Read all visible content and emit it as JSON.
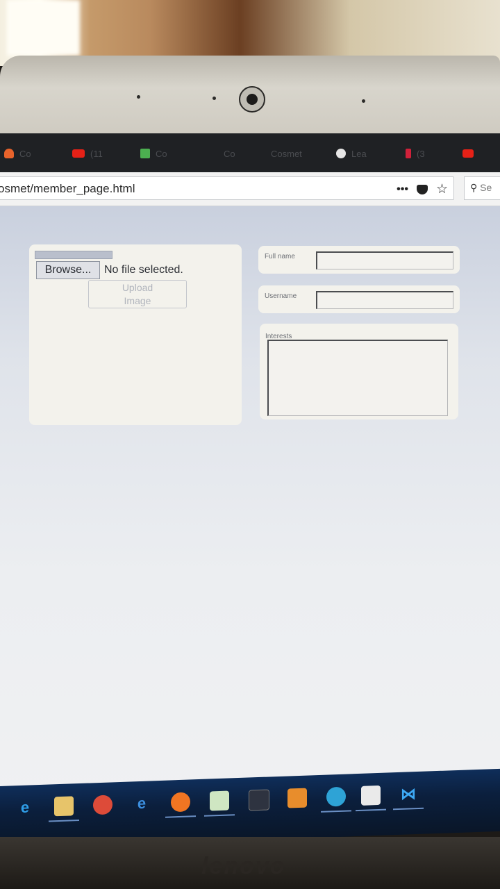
{
  "browser": {
    "tabs": [
      {
        "label": "Co",
        "icon": "fire-icon",
        "color": "#e8632b"
      },
      {
        "label": "(11",
        "icon": "youtube-icon",
        "color": "#e62117"
      },
      {
        "label": "Co",
        "icon": "sheet-icon",
        "color": "#4caf50"
      },
      {
        "label": "Co",
        "icon": "",
        "color": ""
      },
      {
        "label": "Cosmet",
        "icon": "",
        "color": ""
      },
      {
        "label": "Lea",
        "icon": "github-icon",
        "color": "#ffffff"
      },
      {
        "label": "(3",
        "icon": "tag-icon",
        "color": "#d0213a"
      },
      {
        "label": "",
        "icon": "youtube-icon",
        "color": "#e62117"
      }
    ],
    "url": "osmet/member_page.html",
    "menu_icon": "•••",
    "search_placeholder": "Se"
  },
  "upload_panel": {
    "browse_label": "Browse...",
    "file_status": "No file selected.",
    "upload_label_line1": "Upload",
    "upload_label_line2": "Image"
  },
  "profile_form": {
    "full_name_label": "Full name",
    "full_name_value": "",
    "username_label": "Username",
    "username_value": "",
    "interests_label": "Interests",
    "interests_value": ""
  },
  "device": {
    "brand": "lenovo"
  },
  "taskbar": {
    "apps": [
      "edge-icon",
      "file-explorer-icon",
      "chrome-icon",
      "internet-explorer-icon",
      "firefox-icon",
      "notepad-icon",
      "window-icon",
      "sublime-icon",
      "skype-icon",
      "mail-icon",
      "vscode-icon"
    ]
  }
}
